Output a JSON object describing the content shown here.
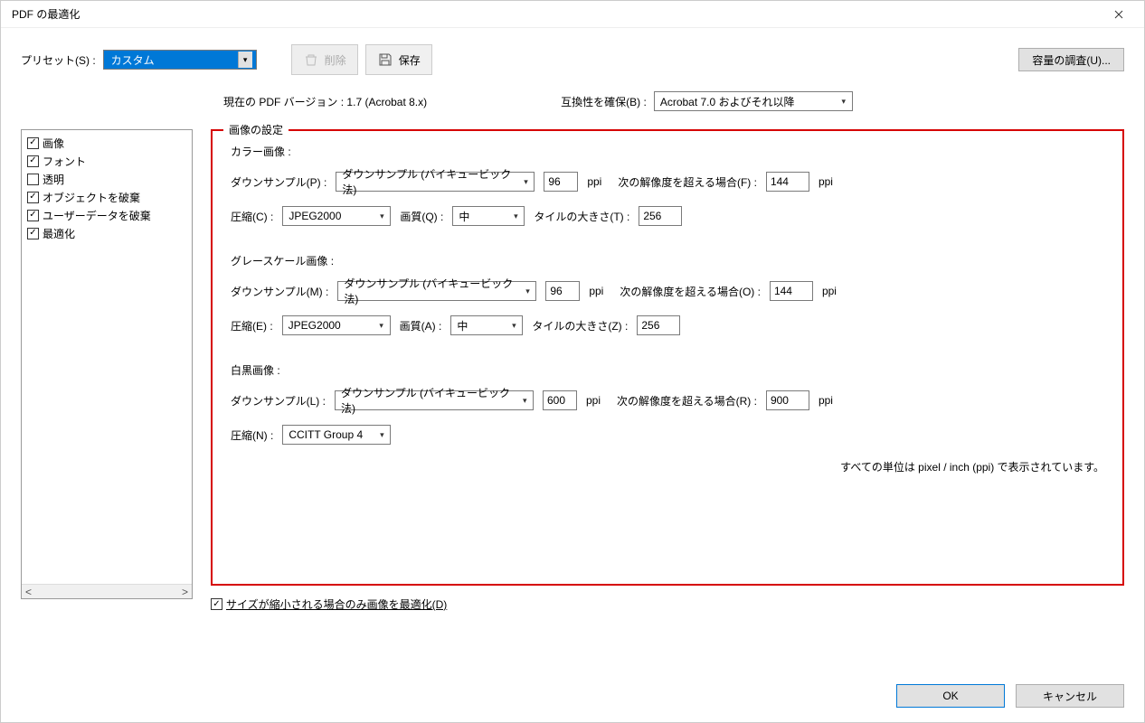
{
  "window": {
    "title": "PDF の最適化"
  },
  "top": {
    "preset_label": "プリセット(S) :",
    "preset_value": "カスタム",
    "delete_label": "削除",
    "save_label": "保存",
    "audit_label": "容量の調査(U)..."
  },
  "row2": {
    "current_version": "現在の PDF バージョン : 1.7 (Acrobat 8.x)",
    "compat_label": "互換性を確保(B) :",
    "compat_value": "Acrobat 7.0 およびそれ以降"
  },
  "sidebar": {
    "items": [
      {
        "label": "画像",
        "checked": true
      },
      {
        "label": "フォント",
        "checked": true
      },
      {
        "label": "透明",
        "checked": false
      },
      {
        "label": "オブジェクトを破棄",
        "checked": true
      },
      {
        "label": "ユーザーデータを破棄",
        "checked": true
      },
      {
        "label": "最適化",
        "checked": true
      }
    ]
  },
  "panel": {
    "legend": "画像の設定",
    "color": {
      "title": "カラー画像 :",
      "ds_label": "ダウンサンプル(P) :",
      "ds_method": "ダウンサンプル (バイキュービック法)",
      "ds_value": "96",
      "ppi": "ppi",
      "over_label": "次の解像度を超える場合(F) :",
      "over_value": "144",
      "comp_label": "圧縮(C) :",
      "comp_value": "JPEG2000",
      "qual_label": "画質(Q) :",
      "qual_value": "中",
      "tile_label": "タイルの大きさ(T) :",
      "tile_value": "256"
    },
    "gray": {
      "title": "グレースケール画像 :",
      "ds_label": "ダウンサンプル(M) :",
      "ds_method": "ダウンサンプル (バイキュービック法)",
      "ds_value": "96",
      "ppi": "ppi",
      "over_label": "次の解像度を超える場合(O) :",
      "over_value": "144",
      "comp_label": "圧縮(E) :",
      "comp_value": "JPEG2000",
      "qual_label": "画質(A) :",
      "qual_value": "中",
      "tile_label": "タイルの大きさ(Z) :",
      "tile_value": "256"
    },
    "mono": {
      "title": "白黒画像 :",
      "ds_label": "ダウンサンプル(L) :",
      "ds_method": "ダウンサンプル (バイキュービック法)",
      "ds_value": "600",
      "ppi": "ppi",
      "over_label": "次の解像度を超える場合(R) :",
      "over_value": "900",
      "comp_label": "圧縮(N) :",
      "comp_value": "CCITT Group 4"
    },
    "unit_note": "すべての単位は pixel / inch (ppi) で表示されています。",
    "opt_only_shrink": "サイズが縮小される場合のみ画像を最適化(D)"
  },
  "footer": {
    "ok": "OK",
    "cancel": "キャンセル"
  }
}
